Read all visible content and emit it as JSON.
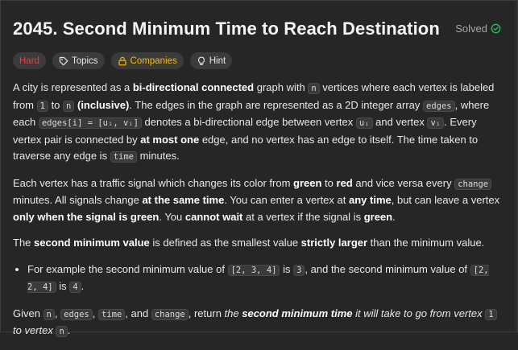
{
  "problem": {
    "title": "2045. Second Minimum Time to Reach Destination",
    "status": "Solved"
  },
  "tags": {
    "difficulty": "Hard",
    "topics": "Topics",
    "companies": "Companies",
    "hint": "Hint"
  },
  "description": {
    "p1": {
      "t1": "A city is represented as a ",
      "b1": "bi-directional connected",
      "t2": " graph with ",
      "c1": "n",
      "t3": " vertices where each vertex is labeled from ",
      "c2": "1",
      "t4": " to ",
      "c3": "n",
      "t5": " ",
      "b2": "(inclusive)",
      "t6": ". The edges in the graph are represented as a 2D integer array ",
      "c4": "edges",
      "t7": ", where each ",
      "c5": "edges[i] = [uᵢ, vᵢ]",
      "t8": " denotes a bi-directional edge between vertex ",
      "c6": "uᵢ",
      "t9": " and vertex ",
      "c7": "vᵢ",
      "t10": ". Every vertex pair is connected by ",
      "b3": "at most one",
      "t11": " edge, and no vertex has an edge to itself. The time taken to traverse any edge is ",
      "c8": "time",
      "t12": " minutes."
    },
    "p2": {
      "t1": "Each vertex has a traffic signal which changes its color from ",
      "b1": "green",
      "t2": " to ",
      "b2": "red",
      "t3": " and vice versa every ",
      "c1": "change",
      "t4": " minutes. All signals change ",
      "b3": "at the same time",
      "t5": ". You can enter a vertex at ",
      "b4": "any time",
      "t6": ", but can leave a vertex ",
      "b5": "only when the signal is green",
      "t7": ". You ",
      "b6": "cannot wait",
      "t8": " at a vertex if the signal is ",
      "b7": "green",
      "t9": "."
    },
    "p3": {
      "t1": "The ",
      "b1": "second minimum value",
      "t2": " is defined as the smallest value ",
      "b2": "strictly larger",
      "t3": " than the minimum value."
    },
    "li1": {
      "t1": "For example the second minimum value of ",
      "c1": "[2, 3, 4]",
      "t2": " is ",
      "c2": "3",
      "t3": ", and the second minimum value of ",
      "c3": "[2, 2, 4]",
      "t4": " is ",
      "c4": "4",
      "t5": "."
    },
    "p4": {
      "t1": "Given ",
      "c1": "n",
      "t2": ", ",
      "c2": "edges",
      "t3": ", ",
      "c3": "time",
      "t4": ", and ",
      "c4": "change",
      "t5": ", return ",
      "e1": "the ",
      "eb1": "second minimum time",
      "e2": " it will take to go from vertex ",
      "c5": "1",
      "e3": " to vertex ",
      "c6": "n",
      "t6": "."
    }
  },
  "colors": {
    "background": "#262626",
    "hard": "#f63737",
    "companies": "#ffb800",
    "solved_check": "#2cbb5d"
  },
  "icons": [
    "tag-icon",
    "lock-icon",
    "lightbulb-icon",
    "check-circle-icon"
  ]
}
